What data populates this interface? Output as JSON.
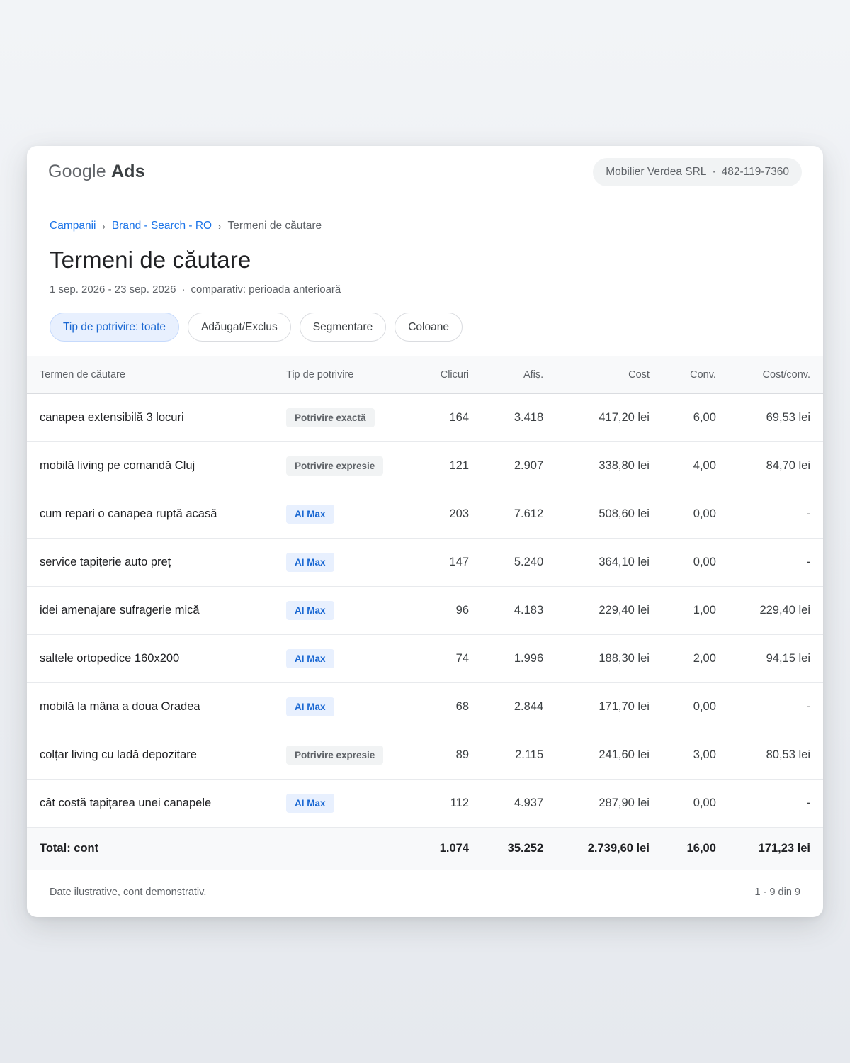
{
  "header": {
    "logo_part1": "Google",
    "logo_part2": "Ads",
    "account_name": "Mobilier Verdea SRL",
    "account_sep": "·",
    "account_id": "482-119-7360"
  },
  "breadcrumb": {
    "items": [
      "Campanii",
      "Brand - Search - RO"
    ],
    "current": "Termeni de căutare",
    "separator": "›"
  },
  "page": {
    "title": "Termeni de căutare",
    "date_range": "1 sep. 2026 - 23 sep. 2026",
    "dot": "·",
    "comparison": "comparativ: perioada anterioară"
  },
  "filters": [
    {
      "label": "Tip de potrivire: toate",
      "active": true
    },
    {
      "label": "Adăugat/Exclus",
      "active": false
    },
    {
      "label": "Segmentare",
      "active": false
    },
    {
      "label": "Coloane",
      "active": false
    }
  ],
  "table": {
    "columns": [
      "Termen de căutare",
      "Tip de potrivire",
      "Clicuri",
      "Afiș.",
      "Cost",
      "Conv.",
      "Cost/conv."
    ],
    "rows": [
      {
        "term": "canapea extensibilă 3 locuri",
        "match": "Potrivire exactă",
        "match_kind": "exact",
        "clicks": "164",
        "impr": "3.418",
        "cost": "417,20 lei",
        "conv": "6,00",
        "cpa": "69,53 lei"
      },
      {
        "term": "mobilă living pe comandă Cluj",
        "match": "Potrivire expresie",
        "match_kind": "phrase",
        "clicks": "121",
        "impr": "2.907",
        "cost": "338,80 lei",
        "conv": "4,00",
        "cpa": "84,70 lei"
      },
      {
        "term": "cum repari o canapea ruptă acasă",
        "match": "AI Max",
        "match_kind": "ai",
        "clicks": "203",
        "impr": "7.612",
        "cost": "508,60 lei",
        "conv": "0,00",
        "cpa": "-"
      },
      {
        "term": "service tapițerie auto preț",
        "match": "AI Max",
        "match_kind": "ai",
        "clicks": "147",
        "impr": "5.240",
        "cost": "364,10 lei",
        "conv": "0,00",
        "cpa": "-"
      },
      {
        "term": "idei amenajare sufragerie mică",
        "match": "AI Max",
        "match_kind": "ai",
        "clicks": "96",
        "impr": "4.183",
        "cost": "229,40 lei",
        "conv": "1,00",
        "cpa": "229,40 lei"
      },
      {
        "term": "saltele ortopedice 160x200",
        "match": "AI Max",
        "match_kind": "ai",
        "clicks": "74",
        "impr": "1.996",
        "cost": "188,30 lei",
        "conv": "2,00",
        "cpa": "94,15 lei"
      },
      {
        "term": "mobilă la mâna a doua Oradea",
        "match": "AI Max",
        "match_kind": "ai",
        "clicks": "68",
        "impr": "2.844",
        "cost": "171,70 lei",
        "conv": "0,00",
        "cpa": "-"
      },
      {
        "term": "colțar living cu ladă depozitare",
        "match": "Potrivire expresie",
        "match_kind": "phrase",
        "clicks": "89",
        "impr": "2.115",
        "cost": "241,60 lei",
        "conv": "3,00",
        "cpa": "80,53 lei"
      },
      {
        "term": "cât costă tapițarea unei canapele",
        "match": "AI Max",
        "match_kind": "ai",
        "clicks": "112",
        "impr": "4.937",
        "cost": "287,90 lei",
        "conv": "0,00",
        "cpa": "-"
      }
    ],
    "total": {
      "label": "Total: cont",
      "clicks": "1.074",
      "impr": "35.252",
      "cost": "2.739,60 lei",
      "conv": "16,00",
      "cpa": "171,23 lei"
    }
  },
  "footer": {
    "note": "Date ilustrative, cont demonstrativ.",
    "pagination": "1 - 9 din 9"
  },
  "colors": {
    "accent": "#1a73e8",
    "ai_badge_bg": "#e8f0fe",
    "neutral_badge_bg": "#f1f3f4"
  }
}
